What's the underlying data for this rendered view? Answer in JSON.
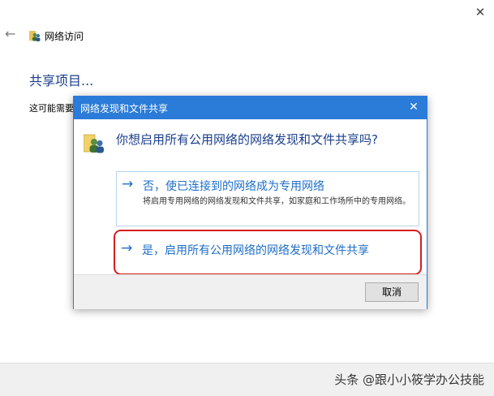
{
  "window": {
    "title": "网络访问",
    "close_glyph": "✕",
    "back_glyph": "←"
  },
  "page": {
    "heading": "共享项目...",
    "body_text": "这可能需要"
  },
  "dialog": {
    "title": "网络发现和文件共享",
    "close_glyph": "✕",
    "question": "你想启用所有公用网络的网络发现和文件共享吗?",
    "option_no": {
      "arrow": "→",
      "label": "否，使已连接到的网络成为专用网络",
      "description": "将启用专用网络的网络发现和文件共享，如家庭和工作场所中的专用网络。"
    },
    "option_yes": {
      "arrow": "→",
      "label": "是，启用所有公用网络的网络发现和文件共享"
    },
    "cancel_label": "取消"
  },
  "watermark": "头条 @跟小小筱学办公技能",
  "colors": {
    "accent": "#2b7bd8",
    "link": "#1e6ec8",
    "heading": "#1a3e8c",
    "highlight": "#d61f1f"
  },
  "icons": {
    "window_icon": "network-users-icon",
    "dialog_icon": "network-users-icon"
  }
}
